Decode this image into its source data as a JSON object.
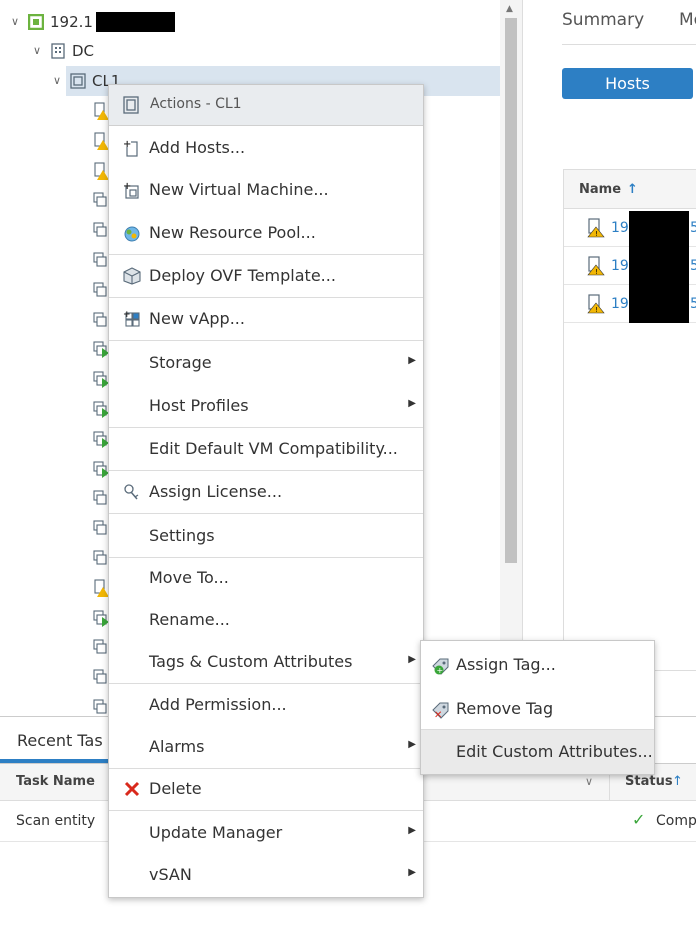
{
  "tree": {
    "root_label": "192.1",
    "datacenter_label": "DC",
    "cluster_label": "CL1"
  },
  "right_panel": {
    "tab_summary": "Summary",
    "tab_monitor": "Mo",
    "hosts_button": "Hosts",
    "grid_header_name": "Name",
    "grid_rows": [
      "192",
      "192",
      "192"
    ],
    "grid_suffix": "5"
  },
  "tasks": {
    "tab_label": "Recent Tas",
    "col_task_name": "Task Name",
    "col_status": "Status",
    "row_task": "Scan entity",
    "row_status": "Comp"
  },
  "context_menu": {
    "header": "Actions - CL1",
    "items": [
      {
        "label": "Add Hosts...",
        "icon": "add-host-icon",
        "submenu": false
      },
      {
        "label": "New Virtual Machine...",
        "icon": "new-vm-icon",
        "submenu": false
      },
      {
        "label": "New Resource Pool...",
        "icon": "resource-pool-icon",
        "submenu": false
      },
      {
        "label": "Deploy OVF Template...",
        "icon": "ovf-icon",
        "submenu": false
      },
      {
        "label": "New vApp...",
        "icon": "vapp-icon",
        "submenu": false
      },
      {
        "label": "Storage",
        "icon": "",
        "submenu": true
      },
      {
        "label": "Host Profiles",
        "icon": "",
        "submenu": true
      },
      {
        "label": "Edit Default VM Compatibility...",
        "icon": "",
        "submenu": false
      },
      {
        "label": "Assign License...",
        "icon": "license-key-icon",
        "submenu": false
      },
      {
        "label": "Settings",
        "icon": "",
        "submenu": false
      },
      {
        "label": "Move To...",
        "icon": "",
        "submenu": false
      },
      {
        "label": "Rename...",
        "icon": "",
        "submenu": false
      },
      {
        "label": "Tags & Custom Attributes",
        "icon": "",
        "submenu": true
      },
      {
        "label": "Add Permission...",
        "icon": "",
        "submenu": false
      },
      {
        "label": "Alarms",
        "icon": "",
        "submenu": true
      },
      {
        "label": "Delete",
        "icon": "delete-x-icon",
        "submenu": false
      },
      {
        "label": "Update Manager",
        "icon": "",
        "submenu": true
      },
      {
        "label": "vSAN",
        "icon": "",
        "submenu": true
      }
    ]
  },
  "submenu": {
    "items": [
      {
        "label": "Assign Tag...",
        "icon": "assign-tag-icon"
      },
      {
        "label": "Remove Tag",
        "icon": "remove-tag-icon"
      },
      {
        "label": "Edit Custom Attributes...",
        "icon": ""
      }
    ]
  },
  "colors": {
    "accent_blue": "#2d7fc4",
    "vsphere_green": "#6cb33f",
    "warning_yellow": "#f2b705",
    "delete_red": "#d9291c"
  }
}
